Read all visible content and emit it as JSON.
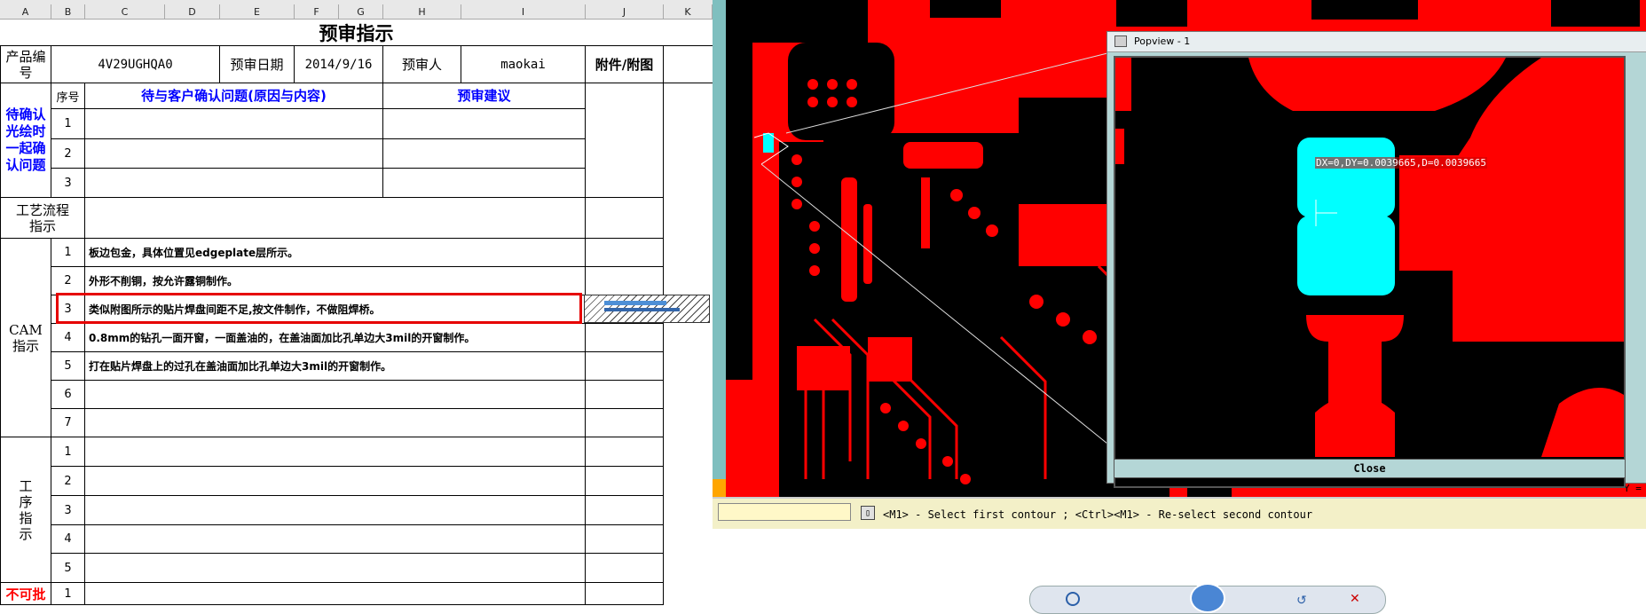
{
  "sheet": {
    "columns": [
      "A",
      "B",
      "C",
      "D",
      "E",
      "F",
      "G",
      "H",
      "I",
      "J",
      "K"
    ],
    "title": "预审指示",
    "header": {
      "product_no_label": "产品编号",
      "product_no": "4V29UGHQA0",
      "review_date_label": "预审日期",
      "review_date": "2014/9/16",
      "reviewer_label": "预审人",
      "reviewer": "maokai",
      "attachment_label": "附件/附图"
    },
    "confirm": {
      "section_label": "待确认光绘时一起确认问题",
      "seq_label": "序号",
      "issues_label": "待与客户确认问题(原因与内容)",
      "suggest_label": "预审建议",
      "rows": [
        "1",
        "2",
        "3"
      ]
    },
    "process": {
      "label": "工艺流程指示"
    },
    "cam": {
      "label": "CAM指示",
      "rows": [
        {
          "no": "1",
          "text": "板边包金，具体位置见edgeplate层所示。"
        },
        {
          "no": "2",
          "text": "外形不削铜，按允许露铜制作。"
        },
        {
          "no": "3",
          "text": "类似附图所示的贴片焊盘间距不足,按文件制作，不做阻焊桥。"
        },
        {
          "no": "4",
          "text": "0.8mm的钻孔一面开窗，一面盖油的，在盖油面加比孔单边大3mil的开窗制作。"
        },
        {
          "no": "5",
          "text": "打在贴片焊盘上的过孔在盖油面加比孔单边大3mil的开窗制作。"
        },
        {
          "no": "6",
          "text": ""
        },
        {
          "no": "7",
          "text": ""
        }
      ]
    },
    "procedure": {
      "label": "工序指示",
      "rows": [
        "1",
        "2",
        "3",
        "4",
        "5"
      ]
    },
    "not_allowed": {
      "label": "不可批",
      "row": "1"
    }
  },
  "cam": {
    "popview_title": "Popview - 1",
    "measure_text": "DX=0,DY=0.0039665,D=0.0039665",
    "close_label": "Close",
    "status_text": "<M1> - Select first contour ; <Ctrl><M1> - Re-select second contour",
    "corner_text": "Y ="
  },
  "colors": {
    "copper": "#ff0000",
    "pad_highlight": "#00ffff",
    "highlight_box": "#e60000"
  }
}
